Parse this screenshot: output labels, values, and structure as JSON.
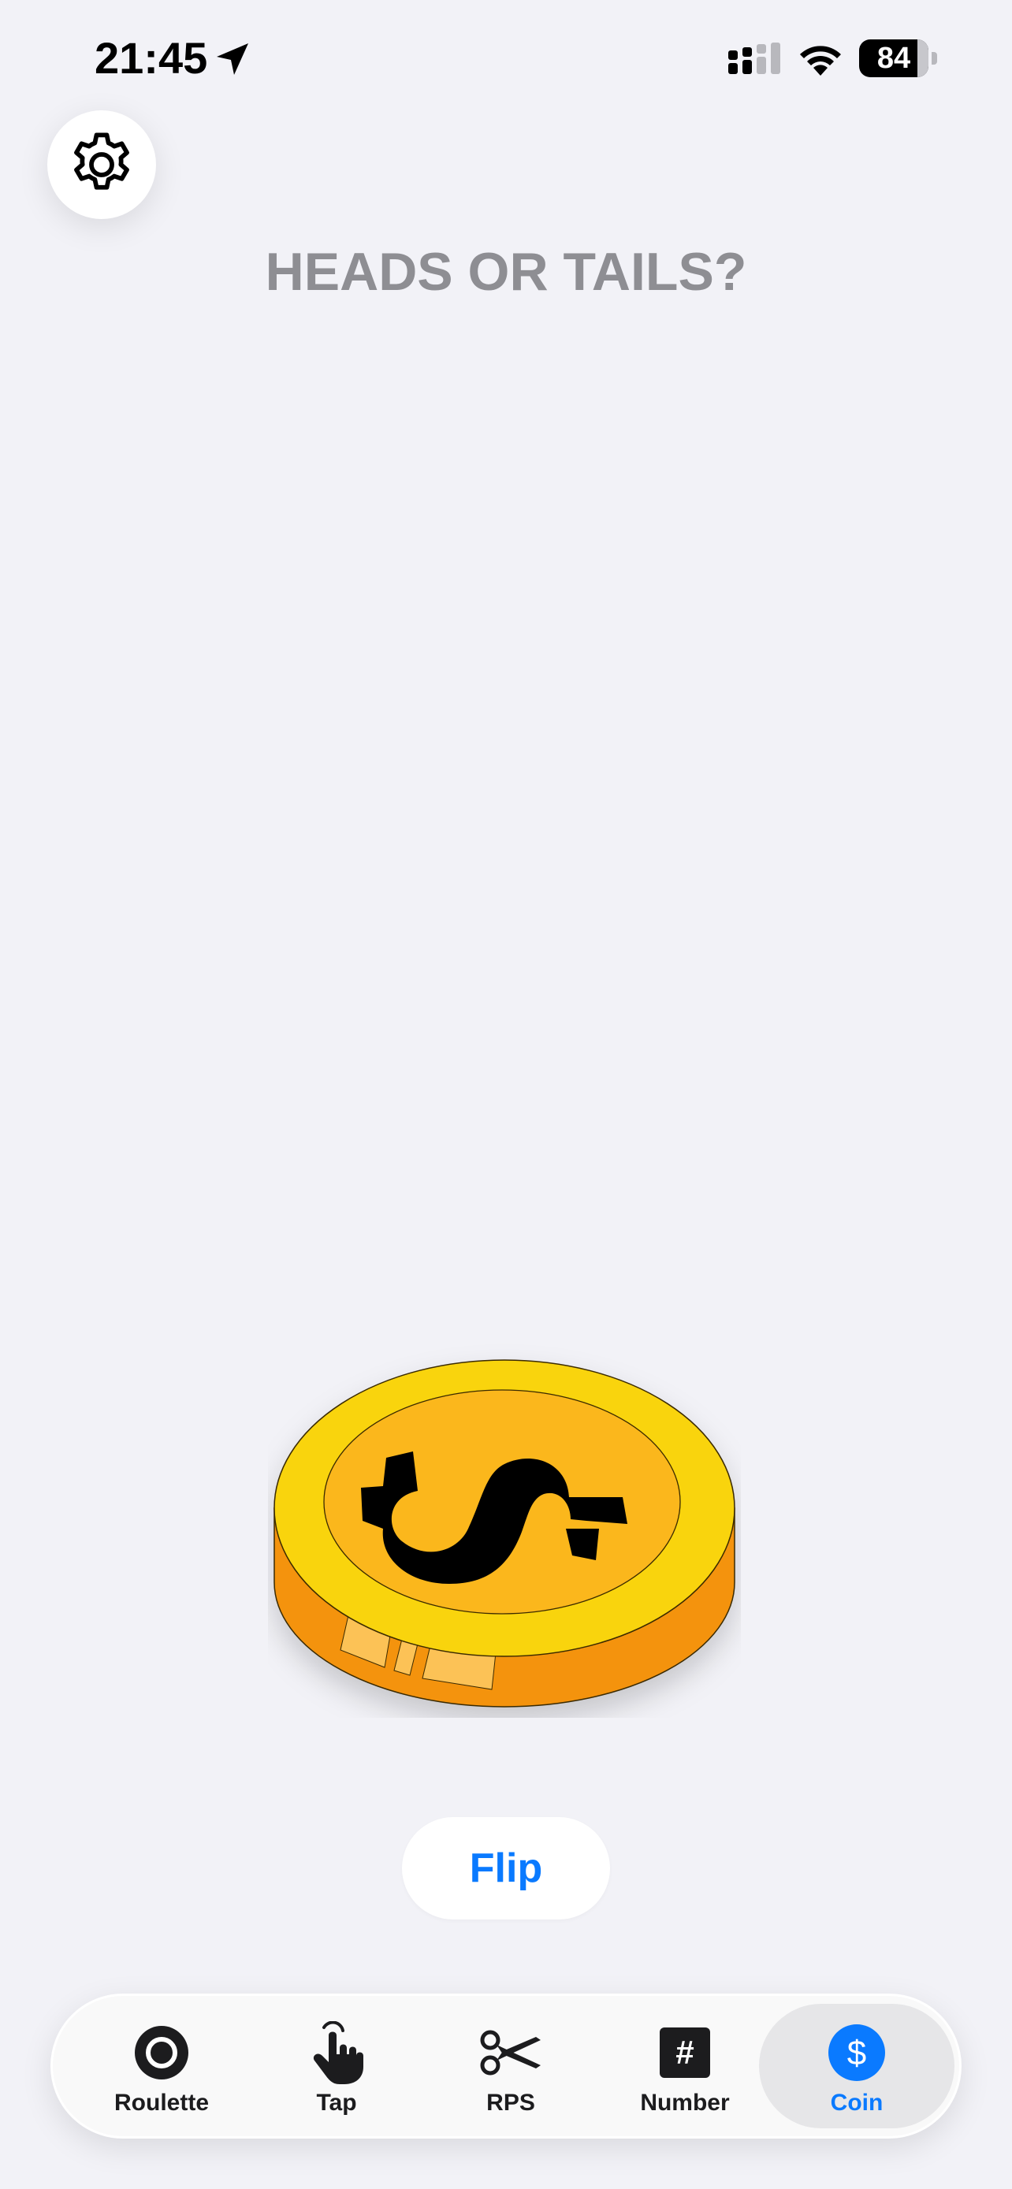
{
  "status_bar": {
    "time": "21:45",
    "battery_percent": "84",
    "battery_level": 0.84
  },
  "header": {
    "title": "HEADS OR TAILS?"
  },
  "coin": {
    "symbol": "$"
  },
  "actions": {
    "flip_label": "Flip"
  },
  "tab_bar": {
    "items": [
      {
        "label": "Roulette",
        "icon": "roulette-icon"
      },
      {
        "label": "Tap",
        "icon": "hand-tap-icon"
      },
      {
        "label": "RPS",
        "icon": "scissors-icon"
      },
      {
        "label": "Number",
        "icon": "hash-icon",
        "glyph": "#"
      },
      {
        "label": "Coin",
        "icon": "dollar-coin-icon",
        "glyph": "$",
        "active": true
      }
    ]
  },
  "colors": {
    "background": "#f2f2f7",
    "accent": "#0a7aff",
    "title": "#8e8e93",
    "coin_face": "#f9d40b",
    "coin_inner": "#fbb71c",
    "coin_edge": "#f4930f"
  }
}
